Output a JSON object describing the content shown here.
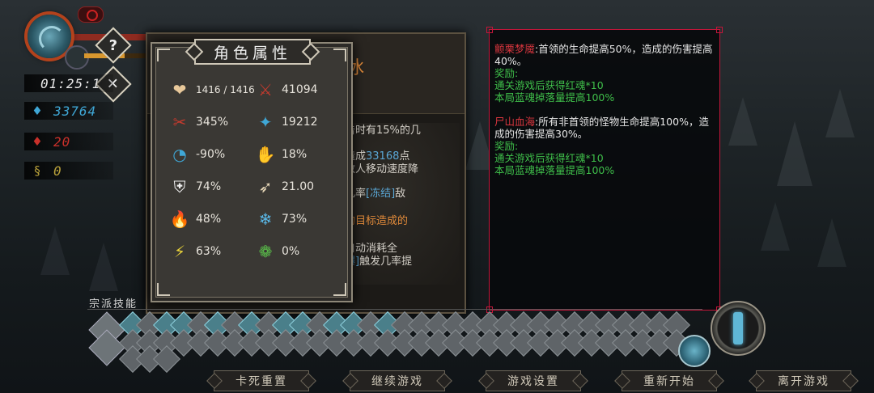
{
  "hud": {
    "timer": "01:25:1",
    "blue_souls": "33764",
    "red_souls": "20",
    "gold": "0",
    "hp_fill": 0.95,
    "xp_fill": 0.55,
    "help_label": "?",
    "close_label": "✕"
  },
  "attributes_panel": {
    "title": "角色属性",
    "stats": [
      {
        "icon": "heart-icon",
        "glyph": "❤",
        "color": "#e8c89a",
        "value": "1416 / 1416"
      },
      {
        "icon": "attack-icon",
        "glyph": "⚔",
        "color": "#c23a2e",
        "value": "41094"
      },
      {
        "icon": "crit-rate-icon",
        "glyph": "✂",
        "color": "#c23a2e",
        "value": "345%"
      },
      {
        "icon": "crit-damage-icon",
        "glyph": "✦",
        "color": "#3fa7d6",
        "value": "19212"
      },
      {
        "icon": "cooldown-icon",
        "glyph": "◔",
        "color": "#3fa7d6",
        "value": "-90%"
      },
      {
        "icon": "dodge-icon",
        "glyph": "✋",
        "color": "#e8d8b8",
        "value": "18%"
      },
      {
        "icon": "defense-icon",
        "glyph": "⛨",
        "color": "#eeeeee",
        "value": "74%"
      },
      {
        "icon": "speed-icon",
        "glyph": "➶",
        "color": "#e8d8b8",
        "value": "21.00"
      },
      {
        "icon": "fire-icon",
        "glyph": "🔥",
        "color": "#e0701e",
        "value": "48%"
      },
      {
        "icon": "ice-icon",
        "glyph": "❄",
        "color": "#5ab7e6",
        "value": "73%"
      },
      {
        "icon": "lightning-icon",
        "glyph": "⚡",
        "color": "#e8d23a",
        "value": "63%"
      },
      {
        "icon": "poison-icon",
        "glyph": "❁",
        "color": "#5abf4a",
        "value": "0%"
      }
    ]
  },
  "skill_panel": {
    "name_fragment": "冰",
    "lines": [
      {
        "pre": "击时有15%的几",
        "hl": "",
        "post": ""
      },
      {
        "pre": "造成",
        "hl": "33168",
        "post": "点"
      },
      {
        "pre": "敌人移动速度降",
        "hl": "",
        "post": ""
      },
      {
        "pre": "。",
        "hl": "",
        "post": ""
      },
      {
        "pre": "几率",
        "hl": "[冻结]",
        "post": "敌"
      },
      {
        "pre": "",
        "hl": "的目标造成的",
        "post": ""
      },
      {
        "pre": "自动消耗全",
        "hl": "",
        "post": ""
      },
      {
        "pre": "",
        "hl": "爆]",
        "post": "触发几率提"
      },
      {
        "pre": "。",
        "hl": "",
        "post": ""
      }
    ]
  },
  "modifiers_panel": {
    "blocks": [
      {
        "name": "颤栗梦魇",
        "desc": ":首领的生命提高50%，造成的伤害提高40%。",
        "reward_label": "奖励:",
        "rewards": [
          "通关游戏后获得红魂*10",
          "本局蓝魂掉落量提高100%"
        ]
      },
      {
        "name": "尸山血海",
        "desc": ":所有非首领的怪物生命提高100%，造成的伤害提高30%。",
        "reward_label": "奖励:",
        "rewards": [
          "通关游戏后获得红魂*10",
          "本局蓝魂掉落量提高100%"
        ]
      }
    ]
  },
  "skillbar": {
    "label": "宗派技能"
  },
  "menu": {
    "buttons": [
      "卡死重置",
      "继续游戏",
      "游戏设置",
      "重新开始",
      "离开游戏"
    ]
  }
}
